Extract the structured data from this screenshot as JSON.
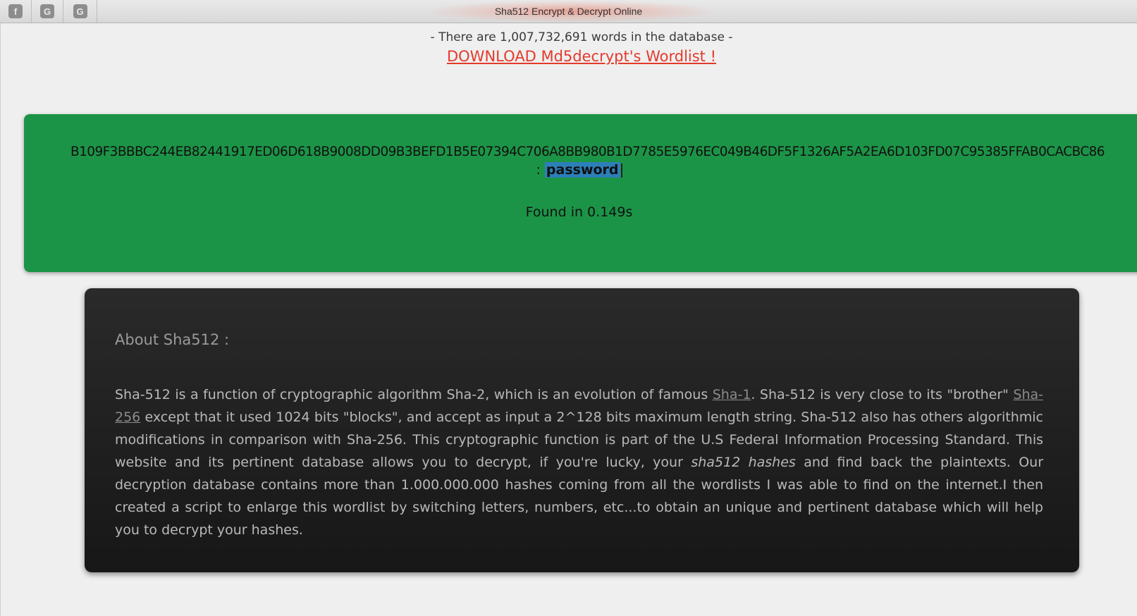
{
  "window": {
    "title": "Sha512 Encrypt & Decrypt Online",
    "toolbar_icons": [
      {
        "name": "facebook-icon",
        "glyph": "f"
      },
      {
        "name": "google-icon",
        "glyph": "G"
      },
      {
        "name": "google-icon",
        "glyph": "G"
      }
    ]
  },
  "header": {
    "db_count_text": "- There are 1,007,732,691 words in the database -",
    "download_link": "DOWNLOAD Md5decrypt's Wordlist !"
  },
  "result": {
    "hash": "B109F3BBBC244EB82441917ED06D618B9008DD09B3BEFD1B5E07394C706A8BB980B1D7785E5976EC049B46DF5F1326AF5A2EA6D103FD07C95385FFAB0CACBC86",
    "separator": ":",
    "plaintext": "password",
    "found_text": "Found in 0.149s"
  },
  "about": {
    "title": "About Sha512 :",
    "p1": "Sha-512 is a function of cryptographic algorithm Sha-2, which is an evolution of famous ",
    "link1": "Sha-1",
    "p2": ". Sha-512 is very close to its \"brother\" ",
    "link2": "Sha-256",
    "p3": " except that it used 1024 bits \"blocks\", and accept as input a 2^128 bits maximum length string. Sha-512 also has others algorithmic modifications in comparison with Sha-256. This cryptographic function is part of the U.S Federal Information Processing Standard. This website and its pertinent database allows you to decrypt, if you're lucky, your ",
    "emphasis": "sha512 hashes",
    "p4": " and find back the plaintexts. Our decryption database contains more than 1.000.000.000 hashes coming from all the wordlists I was able to find on the internet.I then created a script to enlarge this wordlist by switching letters, numbers, etc...to obtain an unique and pertinent database which will help you to decrypt your hashes."
  },
  "colors": {
    "result_bg": "#1c9447",
    "download_link": "#e43a2b",
    "selection": "#2c7fb8",
    "about_bg": "#1f1f1f"
  }
}
